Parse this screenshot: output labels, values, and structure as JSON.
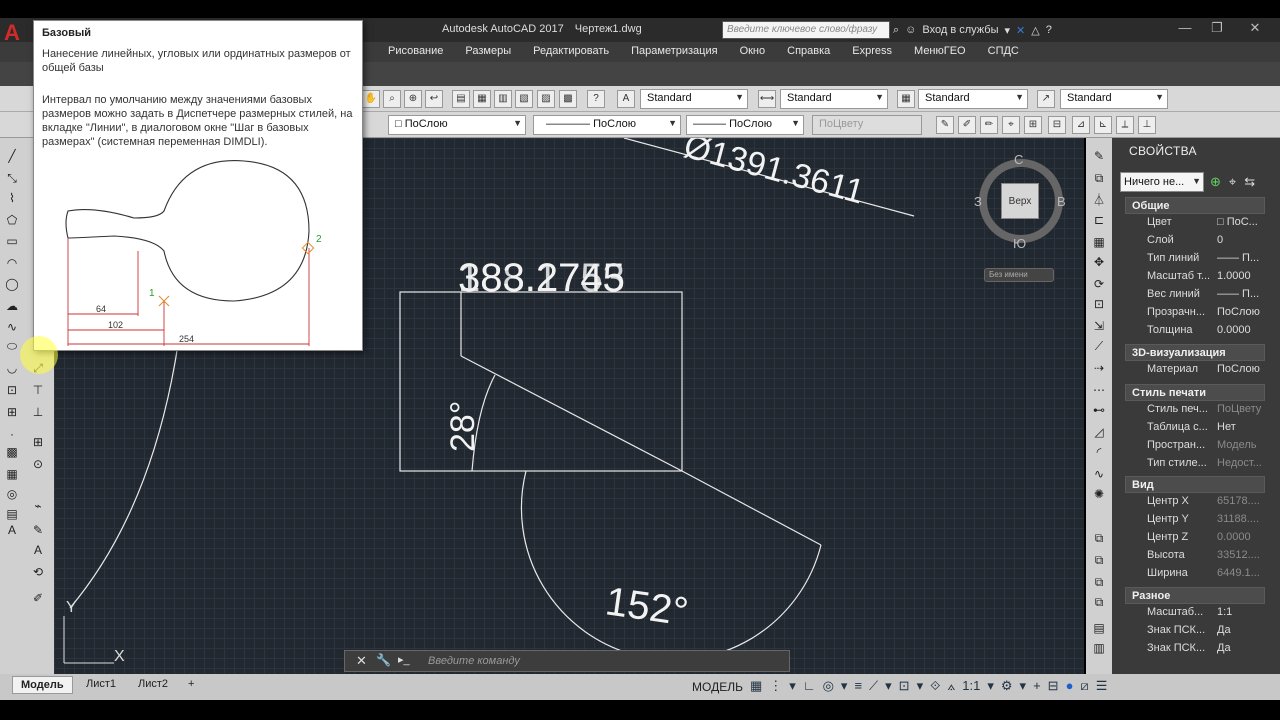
{
  "app": {
    "title": "Autodesk AutoCAD 2017",
    "file": "Чертеж1.dwg",
    "search_placeholder": "Введите ключевое слово/фразу",
    "login": "Вход в службы",
    "logo_letter": "A"
  },
  "menu": [
    "Рисование",
    "Размеры",
    "Редактировать",
    "Параметризация",
    "Окно",
    "Справка",
    "Express",
    "МенюГЕО",
    "СПДС"
  ],
  "toolbar_combos": {
    "text_style": "Standard",
    "dim_style": "Standard",
    "table_style": "Standard",
    "mleader_style": "Standard",
    "layer": "ПоСлою",
    "linetype": "ПоСлою",
    "lineweight": "ПоСлою",
    "plotstyle": "ПоЦвету"
  },
  "tooltip": {
    "title": "Базовый",
    "description": "Нанесение линейных, угловых или ординатных размеров от общей базы",
    "detail": "Интервал по умолчанию между значениями базовых размеров можно задать в Диспетчере размерных стилей, на вкладке \"Линии\", в диалоговом окне \"Шаг в базовых размерах\" (системная переменная DIMDLI).",
    "dims": [
      "64",
      "102",
      "254"
    ],
    "points": [
      "1",
      "2"
    ]
  },
  "drawing": {
    "dim_top": "Ø1391.3611",
    "dim_overlap": "383.2745",
    "dim_overlap2": "188.1753",
    "angle_small": "28°",
    "angle_large": "152°",
    "ucs_x": "X",
    "ucs_y": "Y"
  },
  "viewcube": {
    "north": "С",
    "south": "Ю",
    "east": "В",
    "west": "З",
    "face": "Верх",
    "ucs_name": "Без имени"
  },
  "properties": {
    "title": "СВОЙСТВА",
    "selection": "Ничего не...",
    "sections": [
      {
        "name": "Общие",
        "rows": [
          {
            "k": "Цвет",
            "v": "□ ПоС..."
          },
          {
            "k": "Слой",
            "v": "0"
          },
          {
            "k": "Тип линий",
            "v": "—— П..."
          },
          {
            "k": "Масштаб т...",
            "v": "1.0000"
          },
          {
            "k": "Вес линий",
            "v": "—— П..."
          },
          {
            "k": "Прозрачн...",
            "v": "ПоСлою"
          },
          {
            "k": "Толщина",
            "v": "0.0000"
          }
        ]
      },
      {
        "name": "3D-визуализация",
        "rows": [
          {
            "k": "Материал",
            "v": "ПоСлою"
          }
        ]
      },
      {
        "name": "Стиль печати",
        "rows": [
          {
            "k": "Стиль печ...",
            "v": "ПоЦвету",
            "dim": true
          },
          {
            "k": "Таблица с...",
            "v": "Нет"
          },
          {
            "k": "Простран...",
            "v": "Модель",
            "dim": true
          },
          {
            "k": "Тип стиле...",
            "v": "Недост...",
            "dim": true
          }
        ]
      },
      {
        "name": "Вид",
        "rows": [
          {
            "k": "Центр X",
            "v": "65178....",
            "dim": true
          },
          {
            "k": "Центр Y",
            "v": "31188....",
            "dim": true
          },
          {
            "k": "Центр Z",
            "v": "0.0000",
            "dim": true
          },
          {
            "k": "Высота",
            "v": "33512....",
            "dim": true
          },
          {
            "k": "Ширина",
            "v": "6449.1...",
            "dim": true
          }
        ]
      },
      {
        "name": "Разное",
        "rows": [
          {
            "k": "Масштаб...",
            "v": "1:1"
          },
          {
            "k": "Знак ПСК...",
            "v": "Да"
          },
          {
            "k": "Знак ПСК...",
            "v": "Да"
          }
        ]
      }
    ]
  },
  "command": {
    "placeholder": "Введите команду"
  },
  "status": {
    "tabs": [
      "Модель",
      "Лист1",
      "Лист2"
    ],
    "model": "МОДЕЛЬ",
    "scale": "1:1"
  }
}
